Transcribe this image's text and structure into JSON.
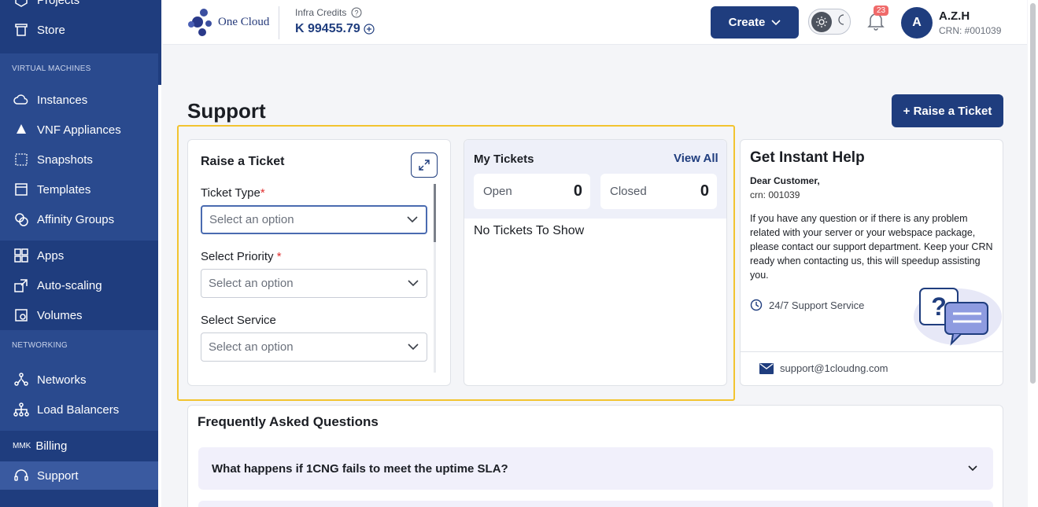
{
  "sidebar": {
    "top_items": [
      {
        "label": "Projects",
        "icon": "projects-icon"
      },
      {
        "label": "Store",
        "icon": "store-icon"
      }
    ],
    "vm_heading": "VIRTUAL MACHINES",
    "vm_items": [
      {
        "label": "Instances",
        "icon": "cloud-icon"
      },
      {
        "label": "VNF Appliances",
        "icon": "vnf-icon"
      },
      {
        "label": "Snapshots",
        "icon": "snapshot-icon"
      },
      {
        "label": "Templates",
        "icon": "template-icon"
      },
      {
        "label": "Affinity Groups",
        "icon": "affinity-icon"
      }
    ],
    "app_items": [
      {
        "label": "Apps",
        "icon": "apps-grid-icon"
      },
      {
        "label": "Auto-scaling",
        "icon": "autoscale-icon"
      },
      {
        "label": "Volumes",
        "icon": "volumes-icon"
      }
    ],
    "net_heading": "NETWORKING",
    "net_items": [
      {
        "label": "Networks",
        "icon": "network-icon"
      },
      {
        "label": "Load Balancers",
        "icon": "load-balancer-icon"
      }
    ],
    "billing_prefix": "MMK",
    "billing_label": "Billing",
    "support_label": "Support"
  },
  "topbar": {
    "logo_text": "One Cloud",
    "credits_label": "Infra Credits",
    "credits_value": "K 99455.79",
    "create_label": "Create",
    "notification_count": "23",
    "avatar_letter": "A",
    "user_name": "A.Z.H",
    "user_crn": "CRN: #001039"
  },
  "main": {
    "page_title": "Support",
    "raise_button": "+ Raise a Ticket",
    "ticket_form": {
      "title": "Raise a Ticket",
      "fields": [
        {
          "label": "Ticket Type",
          "required": "*",
          "placeholder": "Select an option"
        },
        {
          "label": "Select Priority ",
          "required": "*",
          "placeholder": "Select an option"
        },
        {
          "label": "Select Service",
          "required": "",
          "placeholder": "Select an option"
        }
      ]
    },
    "my_tickets": {
      "title": "My Tickets",
      "view_all": "View All",
      "open_label": "Open",
      "open_count": "0",
      "closed_label": "Closed",
      "closed_count": "0",
      "empty_text": "No Tickets To Show"
    },
    "help": {
      "title": "Get Instant Help",
      "greeting": "Dear Customer,",
      "crn": "crn: 001039",
      "body": "If you have any question or if there is any problem related with your server or your webspace package, please contact our support department. Keep your CRN ready when contacting us, this will speedup assisting you.",
      "service": "24/7 Support Service",
      "email": "support@1cloudng.com"
    },
    "faq": {
      "title": "Frequently Asked Questions",
      "items": [
        "What happens if 1CNG fails to meet the uptime SLA?"
      ]
    }
  },
  "colors": {
    "sidebar_bg": "#1f3d7e",
    "accent": "#1f3d7e",
    "highlight": "#f2c430",
    "badge": "#f06a6a"
  }
}
